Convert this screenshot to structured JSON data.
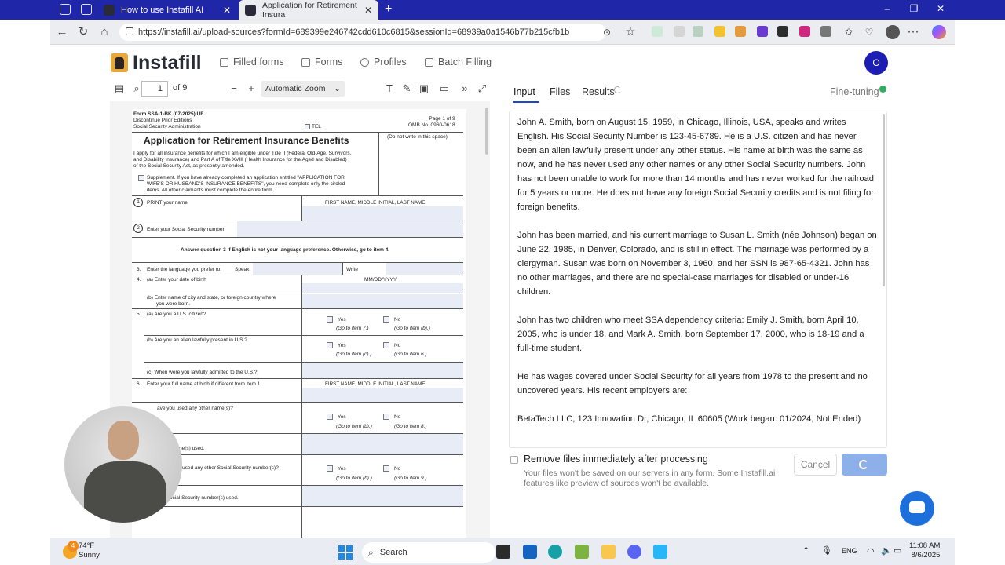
{
  "browser": {
    "tabs": [
      {
        "title": "How to use Instafill AI",
        "active": false
      },
      {
        "title": "Application for Retirement Insura",
        "active": true
      }
    ],
    "url": "https://instafill.ai/upload-sources?formId=689399e246742cdd610c6815&sessionId=68939a0a1546b77b215cfb1b",
    "new_tab": "+",
    "tab_close": "✕",
    "win_min": "–",
    "win_max": "❐",
    "win_close": "✕"
  },
  "app": {
    "logo": "Instafill",
    "nav": [
      "Filled forms",
      "Forms",
      "Profiles",
      "Batch Filling"
    ],
    "avatar_letter": "O"
  },
  "pdf_toolbar": {
    "page": "1",
    "of_pages": "of 9",
    "zoom": "Automatic Zoom"
  },
  "pdf": {
    "header_left": [
      "Form SSA-1-BK (07-2025) UF",
      "Discontinue Prior Editions",
      "Social Security Administration"
    ],
    "header_tel": "TEL",
    "header_right": [
      "Page 1 of 9",
      "OMB No. 0960-0618"
    ],
    "title": "Application for Retirement Insurance Benefits",
    "do_not_write": "(Do not write in this space)",
    "intro": [
      "I apply for all insurance benefits for which I am eligible under Title II (Federal Old-Age, Survivors,",
      "and Disability Insurance) and Part A of Title XVIII (Health Insurance for the Aged and Disabled)",
      "of the Social Security Act, as presently amended."
    ],
    "supplement": [
      "Supplement. If you have already completed an application entitled \"APPLICATION FOR",
      "WIFE'S OR HUSBAND'S INSURANCE BENEFITS\", you need complete only the circled",
      "items. All other claimants must complete the entire form."
    ],
    "item1_num": "1",
    "item1": "PRINT your name",
    "name_header": "FIRST NAME, MIDDLE INITIAL, LAST NAME",
    "item2_num": "2",
    "item2": "Enter your Social Security number",
    "answer_q3": "Answer question 3 if English is not your language preference. Otherwise, go to item 4.",
    "item3_num": "3.",
    "item3": "Enter the language you prefer to:",
    "speak": "Speak",
    "write": "Write",
    "item4_num": "4.",
    "item4a": "(a) Enter your date of birth",
    "dob_format": "MM/DD/YYYY",
    "item4b": [
      "(b) Enter name of city and state, or foreign  country where",
      "you were born."
    ],
    "item5_num": "5.",
    "item5a": "(a) Are you a U.S. citizen?",
    "item5b": "(b) Are you an alien lawfully present in U.S.?",
    "item5c": "(c) When were you lawfully admitted to the U.S.?",
    "item6_num": "6.",
    "item6": "Enter your full name at birth if different from item 1.",
    "item7_frag": "ave you used any other name(s)?",
    "item7b_frag": "ne(s) used.",
    "item8_frag": "used any other Social Security number(s)?",
    "item8b_frag": "er Social Security number(s) used.",
    "yes": "Yes",
    "no": "No",
    "goto": [
      [
        "(Go to item 7.)",
        "(Go to item (b).)"
      ],
      [
        "(Go to item (c).)",
        "(Go to item 6.)"
      ],
      [
        "(Go to item (b).)",
        "(Go to item 8.)"
      ],
      [
        "(Go to item (b).)",
        "(Go to item 9.)"
      ]
    ]
  },
  "panel": {
    "tabs": [
      "Input",
      "Files",
      "Results"
    ],
    "fine_tuning": "Fine-tuning",
    "paragraphs": [
      "John A. Smith, born on August 15, 1959, in Chicago, Illinois, USA, speaks and writes English. His Social Security Number is 123-45-6789. He is a U.S. citizen and has never been an alien lawfully present under any other status. His name at birth was the same as now, and he has never used any other names or any other Social Security numbers. John has not been unable to work for more than 14 months and has never worked for the railroad for 5 years or more. He does not have any foreign Social Security credits and is not filing for foreign benefits.",
      "John has been married, and his current marriage to Susan L. Smith (née Johnson) began on June 22, 1985, in Denver, Colorado, and is still in effect. The marriage was performed by a clergyman. Susan was born on November 3, 1960, and her SSN is 987-65-4321. John has no other marriages, and there are no special-case marriages for disabled or under-16 children.",
      "John has two children who meet SSA dependency criteria: Emily J. Smith, born April 10, 2005, who is under 18, and Mark A. Smith, born September 17, 2000, who is 18-19 and a full-time student.",
      "He has wages covered under Social Security for all years from 1978 to the present and no uncovered years. His recent employers are:",
      "BetaTech LLC, 123 Innovation Dr, Chicago, IL 60605 (Work began: 01/2024, Not Ended)"
    ],
    "remove_files_label": "Remove files immediately after processing",
    "remove_files_note": "Your files won't be saved on our servers in any form. Some Instafill.ai features like preview of sources won't be available.",
    "cancel": "Cancel"
  },
  "taskbar": {
    "weather_badge": "4",
    "temp": "74°F",
    "condition": "Sunny",
    "search": "Search",
    "lang": "ENG",
    "time": "11:08 AM",
    "date": "8/6/2025"
  }
}
